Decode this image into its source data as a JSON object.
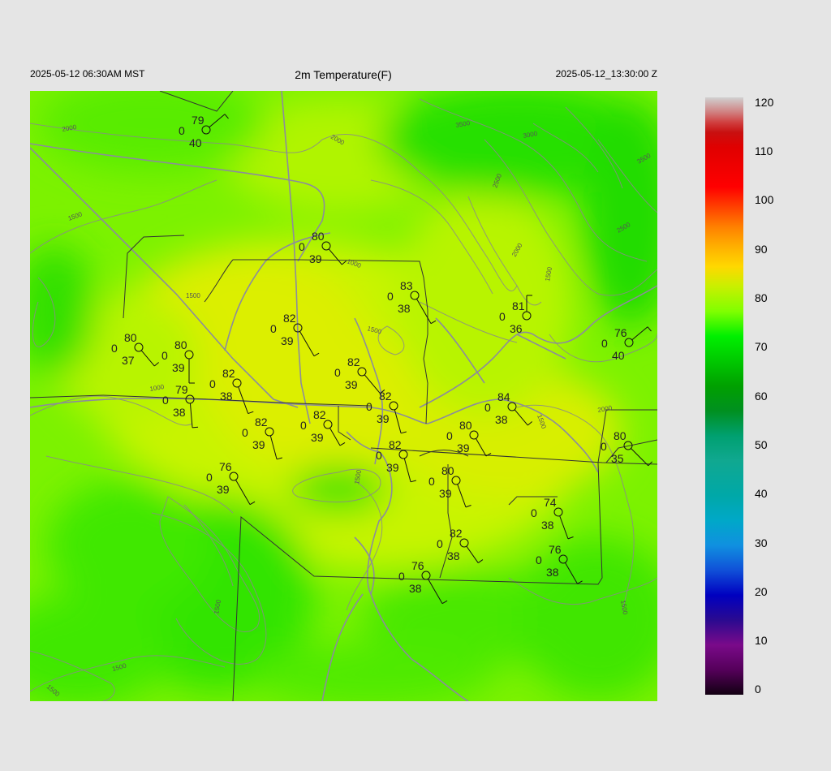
{
  "header": {
    "local_time": "2025-05-12 06:30AM MST",
    "title": "2m Temperature(F)",
    "utc_time": "2025-05-12_13:30:00 Z"
  },
  "colorbar": {
    "labels": [
      "120",
      "110",
      "100",
      "90",
      "80",
      "70",
      "60",
      "50",
      "40",
      "30",
      "20",
      "10",
      "0"
    ],
    "min": 0,
    "max": 120,
    "stops": [
      [
        0,
        "#120012"
      ],
      [
        5,
        "#55005a"
      ],
      [
        10,
        "#7a0a8a"
      ],
      [
        15,
        "#2a0a90"
      ],
      [
        20,
        "#0000c0"
      ],
      [
        25,
        "#1050d8"
      ],
      [
        30,
        "#1090e0"
      ],
      [
        35,
        "#00a8c8"
      ],
      [
        40,
        "#00a8a8"
      ],
      [
        47,
        "#10a890"
      ],
      [
        52,
        "#00a070"
      ],
      [
        57,
        "#009020"
      ],
      [
        62,
        "#00a000"
      ],
      [
        67,
        "#00c800"
      ],
      [
        72,
        "#00f000"
      ],
      [
        77,
        "#80ff00"
      ],
      [
        82,
        "#c8f000"
      ],
      [
        86,
        "#ffd800"
      ],
      [
        90,
        "#ffb000"
      ],
      [
        94,
        "#ff8000"
      ],
      [
        98,
        "#ff4000"
      ],
      [
        102,
        "#ff0000"
      ],
      [
        110,
        "#e00000"
      ],
      [
        113,
        "#c81010"
      ],
      [
        115,
        "#d04040"
      ],
      [
        117,
        "#d08080"
      ],
      [
        120,
        "#d0d0d0"
      ]
    ]
  },
  "contour_labels": [
    "2000",
    "2000",
    "3500",
    "3000",
    "3500",
    "2500",
    "2500",
    "2000",
    "1500",
    "1500",
    "1000",
    "1500",
    "1000",
    "1500",
    "2000",
    "1500",
    "1500",
    "1500",
    "1500",
    "1500",
    "1500"
  ],
  "stations": [
    {
      "temp": "79",
      "dew": "40",
      "wind": "0"
    },
    {
      "temp": "80",
      "dew": "39",
      "wind": "0"
    },
    {
      "temp": "83",
      "dew": "38",
      "wind": "0"
    },
    {
      "temp": "81",
      "dew": "36",
      "wind": "0"
    },
    {
      "temp": "82",
      "dew": "39",
      "wind": "0"
    },
    {
      "temp": "80",
      "dew": "37",
      "wind": "0"
    },
    {
      "temp": "80",
      "dew": "39",
      "wind": "0"
    },
    {
      "temp": "76",
      "dew": "40",
      "wind": "0"
    },
    {
      "temp": "82",
      "dew": "39",
      "wind": "0"
    },
    {
      "temp": "82",
      "dew": "38",
      "wind": "0"
    },
    {
      "temp": "79",
      "dew": "38",
      "wind": "0"
    },
    {
      "temp": "82",
      "dew": "39",
      "wind": "0"
    },
    {
      "temp": "84",
      "dew": "38",
      "wind": "0"
    },
    {
      "temp": "82",
      "dew": "39",
      "wind": "0"
    },
    {
      "temp": "82",
      "dew": "39",
      "wind": "0"
    },
    {
      "temp": "80",
      "dew": "39",
      "wind": "0"
    },
    {
      "temp": "80",
      "dew": "35",
      "wind": "0"
    },
    {
      "temp": "82",
      "dew": "39",
      "wind": "0"
    },
    {
      "temp": "76",
      "dew": "39",
      "wind": "0"
    },
    {
      "temp": "80",
      "dew": "39",
      "wind": "0"
    },
    {
      "temp": "74",
      "dew": "38",
      "wind": "0"
    },
    {
      "temp": "82",
      "dew": "38",
      "wind": "0"
    },
    {
      "temp": "76",
      "dew": "38",
      "wind": "0"
    },
    {
      "temp": "76",
      "dew": "38",
      "wind": "0"
    }
  ]
}
